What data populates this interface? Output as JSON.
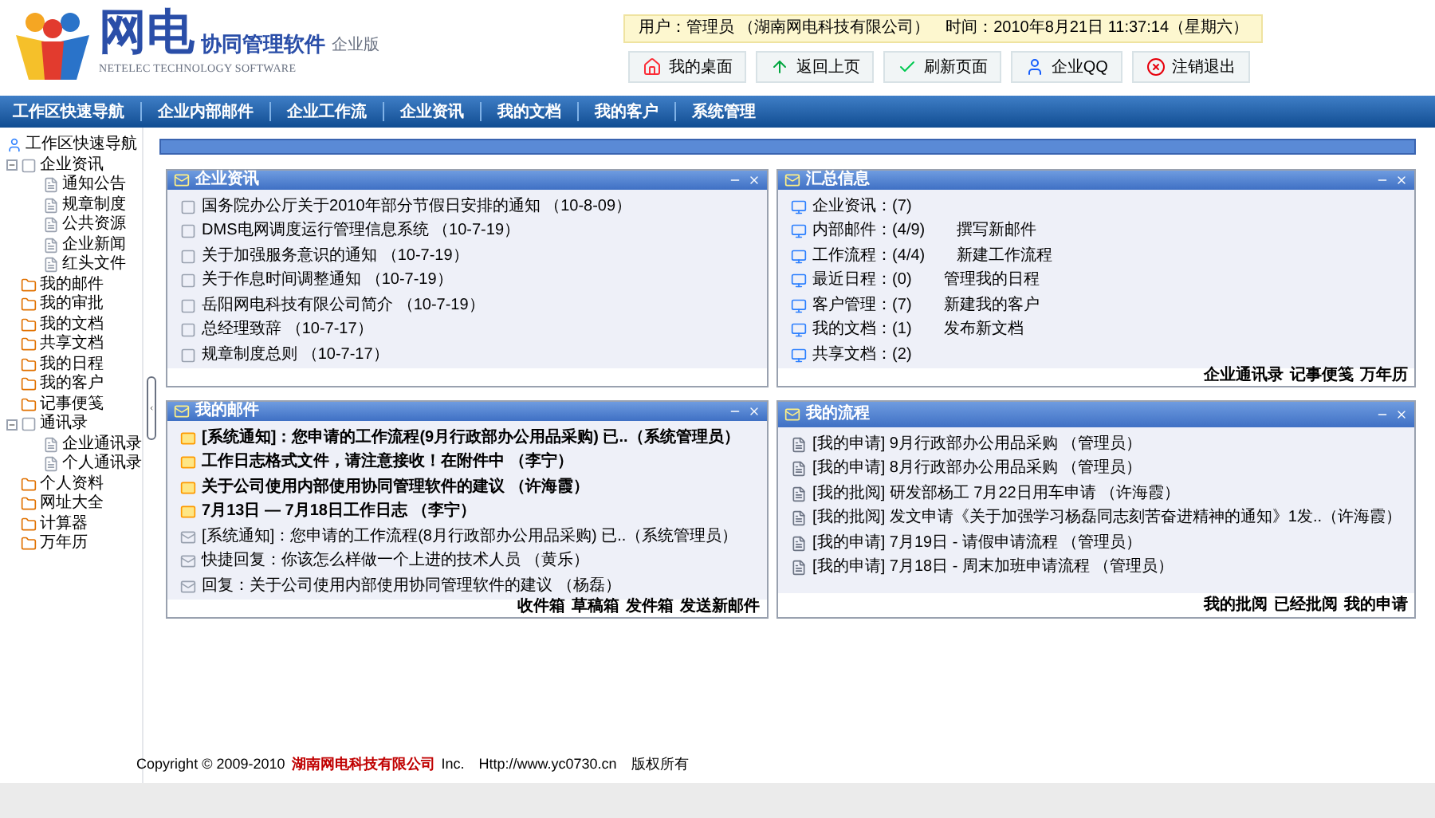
{
  "logo": {
    "brand": "网电",
    "product": "协同管理软件",
    "edition": "企业版",
    "tagline": "NETELEC TECHNOLOGY SOFTWARE"
  },
  "user_info": "用户：管理员 （湖南网电科技有限公司）　时间：2010年8月21日 11:37:14（星期六）",
  "toolbar": [
    {
      "label": "我的桌面",
      "kind": "home"
    },
    {
      "label": "返回上页",
      "kind": "back"
    },
    {
      "label": "刷新页面",
      "kind": "refresh"
    },
    {
      "label": "企业QQ",
      "kind": "qq"
    },
    {
      "label": "注销退出",
      "kind": "logout"
    }
  ],
  "nav": [
    "工作区快速导航",
    "企业内部邮件",
    "企业工作流",
    "企业资讯",
    "我的文档",
    "我的客户",
    "系统管理"
  ],
  "sidebar": {
    "title": "工作区快速导航",
    "items": [
      {
        "label": "企业资讯",
        "expanded": true,
        "children": [
          {
            "label": "通知公告"
          },
          {
            "label": "规章制度"
          },
          {
            "label": "公共资源"
          },
          {
            "label": "企业新闻"
          },
          {
            "label": "红头文件"
          }
        ]
      },
      {
        "label": "我的邮件"
      },
      {
        "label": "我的审批"
      },
      {
        "label": "我的文档"
      },
      {
        "label": "共享文档"
      },
      {
        "label": "我的日程"
      },
      {
        "label": "我的客户"
      },
      {
        "label": "记事便笺"
      },
      {
        "label": "通讯录",
        "expanded": true,
        "children": [
          {
            "label": "企业通讯录"
          },
          {
            "label": "个人通讯录"
          }
        ]
      },
      {
        "label": "个人资料"
      },
      {
        "label": "网址大全"
      },
      {
        "label": "计算器"
      },
      {
        "label": "万年历"
      }
    ]
  },
  "panels": [
    {
      "title": "企业资讯",
      "kind": "news",
      "items": [
        {
          "text": "国务院办公厅关于2010年部分节假日安排的通知 （10-8-09）"
        },
        {
          "text": "DMS电网调度运行管理信息系统 （10-7-19）"
        },
        {
          "text": "关于加强服务意识的通知 （10-7-19）"
        },
        {
          "text": "关于作息时间调整通知 （10-7-19）"
        },
        {
          "text": "岳阳网电科技有限公司简介 （10-7-19）"
        },
        {
          "text": "总经理致辞 （10-7-17）"
        },
        {
          "text": "规章制度总则 （10-7-17）"
        }
      ]
    },
    {
      "title": "汇总信息",
      "kind": "summary",
      "items": [
        {
          "text": "企业资讯：(7)"
        },
        {
          "text": "内部邮件：(4/9)",
          "action": "撰写新邮件"
        },
        {
          "text": "工作流程：(4/4)",
          "action": "新建工作流程"
        },
        {
          "text": "最近日程：(0)",
          "action": "管理我的日程"
        },
        {
          "text": "客户管理：(7)",
          "action": "新建我的客户"
        },
        {
          "text": "我的文档：(1)",
          "action": "发布新文档"
        },
        {
          "text": "共享文档：(2)"
        }
      ],
      "links": [
        "企业通讯录",
        "记事便笺",
        "万年历"
      ]
    },
    {
      "title": "我的邮件",
      "kind": "mail",
      "items": [
        {
          "text": "[系统通知]：您申请的工作流程(9月行政部办公用品采购) 已..（系统管理员）",
          "read": false
        },
        {
          "text": "工作日志格式文件，请注意接收！在附件中 （李宁）",
          "read": false
        },
        {
          "text": "关于公司使用内部使用协同管理软件的建议 （许海霞）",
          "read": false
        },
        {
          "text": "7月13日 — 7月18日工作日志 （李宁）",
          "read": false
        },
        {
          "text": "[系统通知]：您申请的工作流程(8月行政部办公用品采购) 已..（系统管理员）",
          "read": true
        },
        {
          "text": "快捷回复：你该怎么样做一个上进的技术人员 （黄乐）",
          "read": true
        },
        {
          "text": "回复：关于公司使用内部使用协同管理软件的建议 （杨磊）",
          "read": true
        }
      ],
      "links": [
        "收件箱",
        "草稿箱",
        "发件箱",
        "发送新邮件"
      ]
    },
    {
      "title": "我的流程",
      "kind": "flow",
      "items": [
        {
          "text": "[我的申请] 9月行政部办公用品采购 （管理员）"
        },
        {
          "text": "[我的申请] 8月行政部办公用品采购 （管理员）"
        },
        {
          "text": "[我的批阅] 研发部杨工 7月22日用车申请 （许海霞）"
        },
        {
          "text": "[我的批阅] 发文申请《关于加强学习杨磊同志刻苦奋进精神的通知》1发..（许海霞）"
        },
        {
          "text": "[我的申请] 7月19日 - 请假申请流程 （管理员）"
        },
        {
          "text": "[我的申请] 7月18日 - 周末加班申请流程 （管理员）"
        }
      ],
      "links": [
        "我的批阅",
        "已经批阅",
        "我的申请"
      ]
    }
  ],
  "footer": {
    "copyright": "Copyright © 2009-2010",
    "company": "湖南网电科技有限公司",
    "suffix": "Inc.　Http://www.yc0730.cn　版权所有"
  }
}
